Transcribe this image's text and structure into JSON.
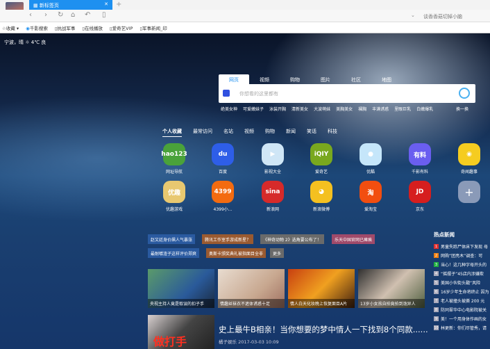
{
  "browser": {
    "tab_title": "新标签页",
    "tab_close": "✕",
    "new_tab": "+",
    "address_hint": "谈香香菇切掉小脑",
    "dropdown": "⌄"
  },
  "bookmarks": [
    {
      "label": "收藏",
      "icon": "star-icon"
    },
    {
      "label": "千影搜索",
      "icon": "search-icon"
    },
    {
      "label": "抗战军事",
      "icon": "page-icon"
    },
    {
      "label": "在线播放",
      "icon": "page-icon"
    },
    {
      "label": "爱奇艺VIP",
      "icon": "page-icon"
    },
    {
      "label": "军事新闻_印",
      "icon": "page-icon"
    }
  ],
  "weather": {
    "text": "宁波，晴",
    "temp": "4℃ 良"
  },
  "search": {
    "tabs": [
      "网页",
      "视频",
      "购物",
      "图片",
      "社区",
      "地图"
    ],
    "placeholder": "你想看的这里都有",
    "hotwords": [
      "绝美女神",
      "可爱嫩妹子",
      "泳装开胸",
      "清新美女",
      "大波萌妹",
      "美胸美女",
      "裸胸",
      "丰满诱惑",
      "里眼巨乳",
      "白嫩爆乳"
    ],
    "refresh": "换一换"
  },
  "categories": [
    "个人收藏",
    "最常访问",
    "名站",
    "视频",
    "购物",
    "新闻",
    "笑话",
    "科技"
  ],
  "apps": [
    {
      "label": "网址导航",
      "glyph": "hao123",
      "color": "#4aa23a"
    },
    {
      "label": "百度",
      "glyph": "du",
      "color": "#2e5ee8"
    },
    {
      "label": "影视大全",
      "glyph": "▶",
      "color": "#cfe6f6"
    },
    {
      "label": "爱奇艺",
      "glyph": "iQIY",
      "color": "#79a81e"
    },
    {
      "label": "优酷",
      "glyph": "●",
      "color": "#c5e6fa"
    },
    {
      "label": "千影有料",
      "glyph": "有料",
      "color": "#6a5ef0"
    },
    {
      "label": "奇闻趣事",
      "glyph": "◉",
      "color": "#f5cc20"
    },
    {
      "label": "优趣游戏",
      "glyph": "优趣",
      "color": "#e8c870"
    },
    {
      "label": "4399小...",
      "glyph": "4399",
      "color": "#f36b10"
    },
    {
      "label": "新浪网",
      "glyph": "sina",
      "color": "#d62a2a"
    },
    {
      "label": "新浪微博",
      "glyph": "◕",
      "color": "#f4c020"
    },
    {
      "label": "爱淘宝",
      "glyph": "淘",
      "color": "#f24e10"
    },
    {
      "label": "京东",
      "glyph": "JD",
      "color": "#d61e1e"
    },
    {
      "label": "",
      "glyph": "+",
      "color": "#8a9ab8"
    }
  ],
  "tags": [
    {
      "label": "赵又廷身价飙人气暴涨",
      "color": "#2a5aa0"
    },
    {
      "label": "腾讯工作室手游成新星？",
      "color": "#9a5a30"
    },
    {
      "label": "《神奇动物 2》选角要公布了！",
      "color": "#6a6a6a"
    },
    {
      "label": "乐天中国官网已瘫痪",
      "color": "#a04a6a"
    },
    {
      "label": "最耐嚼渣子这样评价郑爽",
      "color": "#2a5aa0"
    },
    {
      "label": "奥斯卡颁奖典礼被指面目全非",
      "color": "#9a5a30"
    },
    {
      "label": "更多",
      "color": "#6a6a6a"
    }
  ],
  "thumbs": [
    {
      "caption": "央视主持人竟是取误的扣子手",
      "bg": "linear-gradient(135deg,#5a9a6a,#2a5a9a 60%,#1a2a40)"
    },
    {
      "caption": "情趣丝袜衣不遮体诱惑十足",
      "bg": "linear-gradient(135deg,#e8dcd0,#c8a890 60%,#a07060)"
    },
    {
      "caption": "情人白天化妆晚上恢复面目A片",
      "bg": "linear-gradient(135deg,#c84010,#f0a020 50%,#402010)"
    },
    {
      "caption": "13岁小女孩自拍竟拍到诡异人",
      "bg": "linear-gradient(135deg,#303030,#d0c0b0 50%,#506040)"
    }
  ],
  "featured": {
    "title": "史上最牛B相亲！当你想要的梦中情人一下找到8个同款......",
    "source": "橘子娱乐",
    "date": "2017-03-03 10:09",
    "image_text": "做打手"
  },
  "hot_news": {
    "title": "热点新闻",
    "items": [
      {
        "n": "1",
        "text": "男童失踪尸体床下发现 母",
        "color": "#e03030"
      },
      {
        "n": "2",
        "text": "网购“团亮木”调查：可",
        "color": "#f08010"
      },
      {
        "n": "3",
        "text": "当心！这几种字母开头的",
        "color": "#20b040"
      },
      {
        "n": "4",
        "text": "“摇摆子”45店内涉嫌欺",
        "color": "#aab"
      },
      {
        "n": "5",
        "text": "美国小伙街头戳“风险",
        "color": "#aab"
      },
      {
        "n": "6",
        "text": "16岁少年生命将终止 因为",
        "color": "#aab"
      },
      {
        "n": "7",
        "text": "老人被撞头被撕 200 元",
        "color": "#aab"
      },
      {
        "n": "8",
        "text": "防同翠华中心电影院被关",
        "color": "#aab"
      },
      {
        "n": "9",
        "text": "美！一个用身体作画的女",
        "color": "#aab"
      },
      {
        "n": "10",
        "text": "林更新：你们尽管秀，请",
        "color": "#aab"
      }
    ]
  }
}
